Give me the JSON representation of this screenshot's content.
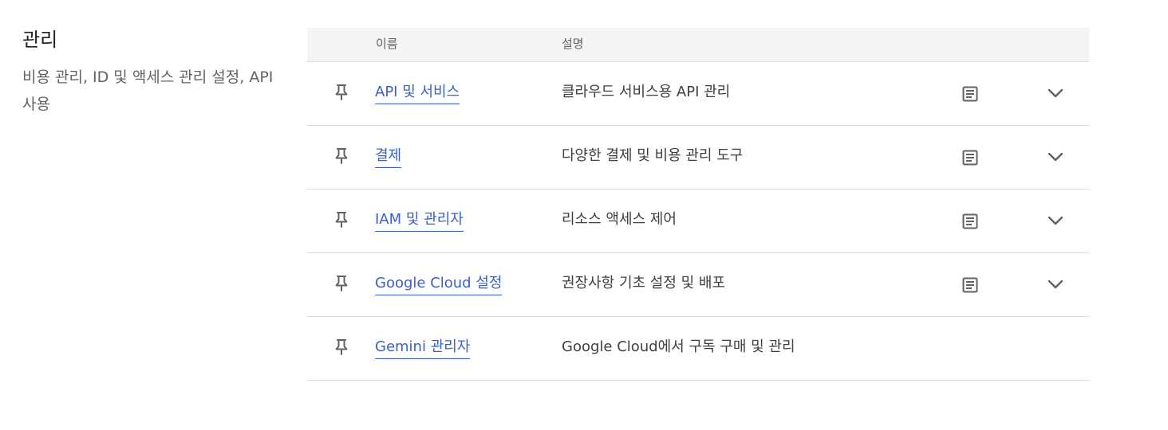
{
  "section": {
    "title": "관리",
    "description": "비용 관리, ID 및 액세스 관리 설정, API 사용"
  },
  "table": {
    "headers": {
      "name": "이름",
      "description": "설명"
    },
    "rows": [
      {
        "name": "API 및 서비스",
        "description": "클라우드 서비스용 API 관리",
        "has_docs_icon": true,
        "has_expand_icon": true
      },
      {
        "name": "결제",
        "description": "다양한 결제 및 비용 관리 도구",
        "has_docs_icon": true,
        "has_expand_icon": true
      },
      {
        "name": "IAM 및 관리자",
        "description": "리소스 액세스 제어",
        "has_docs_icon": true,
        "has_expand_icon": true
      },
      {
        "name": "Google Cloud 설정",
        "description": "권장사항 기초 설정 및 배포",
        "has_docs_icon": true,
        "has_expand_icon": true
      },
      {
        "name": "Gemini 관리자",
        "description": "Google Cloud에서 구독 구매 및 관리",
        "has_docs_icon": false,
        "has_expand_icon": false
      }
    ]
  },
  "icons": {
    "pin": "pin-icon",
    "docs": "article-icon",
    "expand": "chevron-down-icon"
  },
  "colors": {
    "link": "#3b5fc8",
    "header_bg": "#f4f4f4",
    "divider": "#dadce0",
    "icon": "#5f6368"
  }
}
